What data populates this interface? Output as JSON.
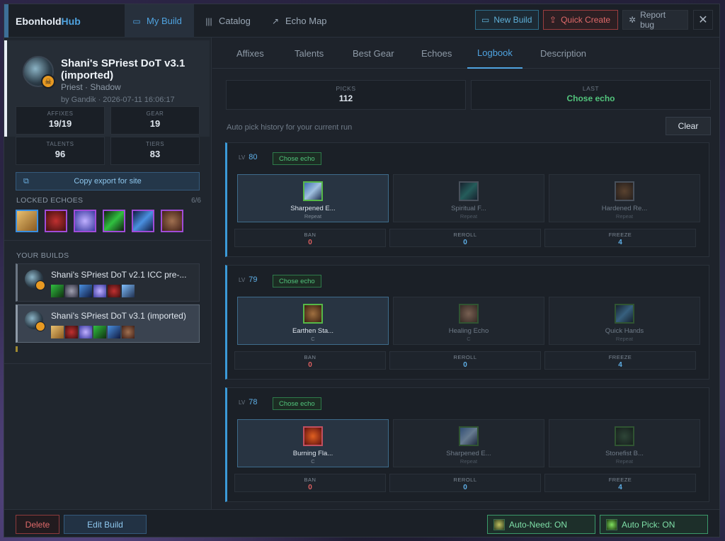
{
  "app": {
    "brand_main": "Ebonhold",
    "brand_accent": "Hub"
  },
  "nav": {
    "tabs": [
      {
        "label": "My Build",
        "icon": "folder-icon"
      },
      {
        "label": "Catalog",
        "icon": "books-icon"
      },
      {
        "label": "Echo Map",
        "icon": "external-link-icon"
      }
    ],
    "new_build": "New Build",
    "quick_create": "Quick Create",
    "report_bug": "Report bug",
    "close": "✕"
  },
  "build": {
    "title": "Shani's SPriest DoT v3.1 (imported)",
    "class": "Priest · Shadow",
    "meta": "by Gandik · 2026-07-11 16:06:17",
    "stats": [
      {
        "label": "AFFIXES",
        "value": "19/19"
      },
      {
        "label": "GEAR",
        "value": "19"
      },
      {
        "label": "TALENTS",
        "value": "96"
      },
      {
        "label": "TIERS",
        "value": "83"
      }
    ],
    "copy_export": "Copy export for site"
  },
  "locked_echoes": {
    "label": "LOCKED ECHOES",
    "count": "6/6"
  },
  "your_builds": {
    "label": "YOUR BUILDS",
    "items": [
      {
        "name": "Shani's SPriest DoT v2.1 ICC pre-..."
      },
      {
        "name": "Shani's SPriest DoT v3.1 (imported)"
      }
    ]
  },
  "subtabs": [
    "Affixes",
    "Talents",
    "Best Gear",
    "Echoes",
    "Logbook",
    "Description"
  ],
  "summary": {
    "picks_label": "PICKS",
    "picks_value": "112",
    "last_label": "LAST",
    "last_value": "Chose echo"
  },
  "hint": "Auto pick history for your current run",
  "clear": "Clear",
  "action_labels": {
    "ban": "BAN",
    "reroll": "REROLL",
    "freeze": "FREEZE"
  },
  "entries": [
    {
      "lv_label": "LV",
      "level": "80",
      "status": "Chose echo",
      "choices": [
        {
          "name": "Sharpened E...",
          "sub": "Repeat"
        },
        {
          "name": "Spiritual F...",
          "sub": "Repeat"
        },
        {
          "name": "Hardened Re...",
          "sub": "Repeat"
        }
      ],
      "ban": "0",
      "reroll": "0",
      "freeze": "4"
    },
    {
      "lv_label": "LV",
      "level": "79",
      "status": "Chose echo",
      "choices": [
        {
          "name": "Earthen Sta...",
          "sub": "C"
        },
        {
          "name": "Healing Echo",
          "sub": "C"
        },
        {
          "name": "Quick Hands",
          "sub": "Repeat"
        }
      ],
      "ban": "0",
      "reroll": "0",
      "freeze": "4"
    },
    {
      "lv_label": "LV",
      "level": "78",
      "status": "Chose echo",
      "choices": [
        {
          "name": "Burning Fla...",
          "sub": "C"
        },
        {
          "name": "Sharpened E...",
          "sub": "Repeat"
        },
        {
          "name": "Stonefist B...",
          "sub": "Repeat"
        }
      ],
      "ban": "0",
      "reroll": "0",
      "freeze": "4"
    }
  ],
  "bottom": {
    "delete": "Delete",
    "edit": "Edit Build",
    "auto_need": "Auto-Need: ON",
    "auto_pick": "Auto Pick: ON"
  },
  "colors": {
    "accent": "#4fa3e0",
    "danger": "#e06a6a",
    "success": "#52c47c",
    "echo_border": "#a04cd8"
  }
}
